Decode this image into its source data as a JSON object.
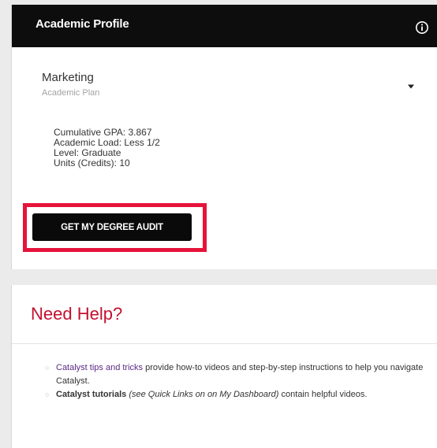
{
  "profile": {
    "title": "Academic Profile",
    "info_icon": "info-circle-icon",
    "plan": {
      "name": "Marketing",
      "label": "Academic Plan",
      "dropdown_icon": "caret-down-icon"
    },
    "stats": {
      "gpa": "Cumulative GPA: 3.867",
      "load": "Academic Load: Less 1/2",
      "level": "Level: Graduate",
      "units": "Units (Credits): 10"
    },
    "audit_button": "GET MY DEGREE AUDIT",
    "highlight_color": "#e6133a",
    "header_bg": "#0d0d0d"
  },
  "help": {
    "title": "Need Help?",
    "title_color": "#c4102f",
    "items": [
      {
        "link": "Catalyst tips and tricks",
        "text": " provide how-to videos and step-by-step instructions to help you navigate Catalyst."
      },
      {
        "bold": "Catalyst tutorials",
        "italic": "(see Quick Links on on My Dashboard)",
        "text": " contain helpful videos."
      }
    ],
    "link_color": "#5b2a86"
  }
}
